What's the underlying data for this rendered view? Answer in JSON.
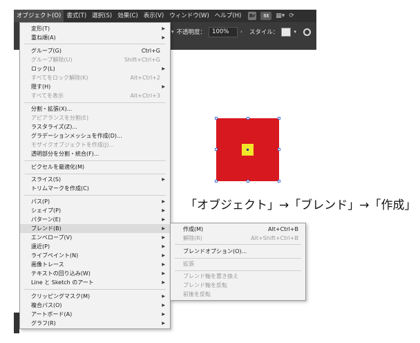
{
  "menubar": {
    "items": [
      "オブジェクト(O)",
      "書式(T)",
      "選択(S)",
      "効果(C)",
      "表示(V)",
      "ウィンドウ(W)",
      "ヘルプ(H)"
    ],
    "active_index": 0,
    "tool_icons": [
      "Br",
      "St"
    ]
  },
  "options_bar": {
    "opacity_label": "不透明度：",
    "opacity_value": "100%",
    "style_label": "スタイル："
  },
  "object_menu": {
    "items": [
      {
        "label": "変形(T)",
        "shortcut": "",
        "submenu": true,
        "disabled": false
      },
      {
        "label": "重ね順(A)",
        "shortcut": "",
        "submenu": true,
        "disabled": false
      },
      {
        "label": "グループ(G)",
        "shortcut": "Ctrl+G",
        "submenu": false,
        "disabled": false
      },
      {
        "label": "グループ解除(U)",
        "shortcut": "Shift+Ctrl+G",
        "submenu": false,
        "disabled": true
      },
      {
        "label": "ロック(L)",
        "shortcut": "",
        "submenu": true,
        "disabled": false
      },
      {
        "label": "すべてをロック解除(K)",
        "shortcut": "Alt+Ctrl+2",
        "submenu": false,
        "disabled": true
      },
      {
        "label": "隠す(H)",
        "shortcut": "",
        "submenu": true,
        "disabled": false
      },
      {
        "label": "すべてを表示",
        "shortcut": "Alt+Ctrl+3",
        "submenu": false,
        "disabled": true
      },
      {
        "label": "分割・拡張(X)...",
        "shortcut": "",
        "submenu": false,
        "disabled": false
      },
      {
        "label": "アピアランスを分割(E)",
        "shortcut": "",
        "submenu": false,
        "disabled": true
      },
      {
        "label": "ラスタライズ(Z)...",
        "shortcut": "",
        "submenu": false,
        "disabled": false
      },
      {
        "label": "グラデーションメッシュを作成(D)...",
        "shortcut": "",
        "submenu": false,
        "disabled": false
      },
      {
        "label": "モザイクオブジェクトを作成(J)...",
        "shortcut": "",
        "submenu": false,
        "disabled": true
      },
      {
        "label": "透明部分を分割・統合(F)...",
        "shortcut": "",
        "submenu": false,
        "disabled": false
      },
      {
        "label": "ピクセルを最適化(M)",
        "shortcut": "",
        "submenu": false,
        "disabled": false
      },
      {
        "label": "スライス(S)",
        "shortcut": "",
        "submenu": true,
        "disabled": false
      },
      {
        "label": "トリムマークを作成(C)",
        "shortcut": "",
        "submenu": false,
        "disabled": false
      },
      {
        "label": "パス(P)",
        "shortcut": "",
        "submenu": true,
        "disabled": false
      },
      {
        "label": "シェイプ(P)",
        "shortcut": "",
        "submenu": true,
        "disabled": false
      },
      {
        "label": "パターン(E)",
        "shortcut": "",
        "submenu": true,
        "disabled": false
      },
      {
        "label": "ブレンド(B)",
        "shortcut": "",
        "submenu": true,
        "disabled": false
      },
      {
        "label": "エンベロープ(V)",
        "shortcut": "",
        "submenu": true,
        "disabled": false
      },
      {
        "label": "遠近(P)",
        "shortcut": "",
        "submenu": true,
        "disabled": false
      },
      {
        "label": "ライブペイント(N)",
        "shortcut": "",
        "submenu": true,
        "disabled": false
      },
      {
        "label": "画像トレース",
        "shortcut": "",
        "submenu": true,
        "disabled": false
      },
      {
        "label": "テキストの回り込み(W)",
        "shortcut": "",
        "submenu": true,
        "disabled": false
      },
      {
        "label": "Line と Sketch のアート",
        "shortcut": "",
        "submenu": true,
        "disabled": false
      },
      {
        "label": "クリッピングマスク(M)",
        "shortcut": "",
        "submenu": true,
        "disabled": false
      },
      {
        "label": "複合パス(O)",
        "shortcut": "",
        "submenu": true,
        "disabled": false
      },
      {
        "label": "アートボード(A)",
        "shortcut": "",
        "submenu": true,
        "disabled": false
      },
      {
        "label": "グラフ(R)",
        "shortcut": "",
        "submenu": true,
        "disabled": false
      }
    ],
    "highlighted": "ブレンド(B)"
  },
  "blend_submenu": {
    "items": [
      {
        "label": "作成(M)",
        "shortcut": "Alt+Ctrl+B",
        "disabled": false
      },
      {
        "label": "解除(R)",
        "shortcut": "Alt+Shift+Ctrl+B",
        "disabled": true
      },
      {
        "label": "ブレンドオプション(O)...",
        "shortcut": "",
        "disabled": false
      },
      {
        "label": "拡張",
        "shortcut": "",
        "disabled": true
      },
      {
        "label": "ブレンド軸を置き換え",
        "shortcut": "",
        "disabled": true
      },
      {
        "label": "ブレンド軸を反転",
        "shortcut": "",
        "disabled": true
      },
      {
        "label": "前後を反転",
        "shortcut": "",
        "disabled": true
      }
    ]
  },
  "caption": "「オブジェクト」→「ブレンド」→「作成」",
  "colors": {
    "outer_square": "#d8181f",
    "inner_square": "#f2e629",
    "selection": "#4a6fd1",
    "chrome_dark": "#2f2f2f"
  }
}
